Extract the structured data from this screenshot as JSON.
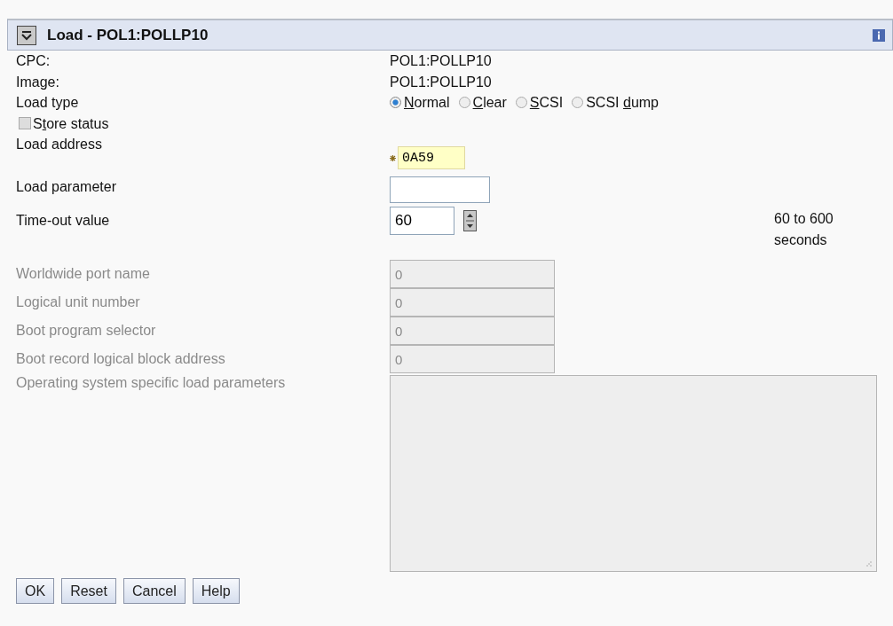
{
  "header": {
    "title": "Load - POL1:POLLP10",
    "expanded": true
  },
  "info_rows": [
    {
      "label": "CPC:",
      "value": "POL1:POLLP10"
    },
    {
      "label": "Image:",
      "value": "POL1:POLLP10"
    }
  ],
  "load_type": {
    "label": "Load type",
    "options": [
      {
        "key": "N",
        "post": "ormal",
        "selected": true
      },
      {
        "key": "C",
        "post": "lear",
        "selected": false
      },
      {
        "key": "S",
        "post": "CSI",
        "selected": false
      },
      {
        "pre": "SCSI ",
        "key": "d",
        "post": "ump",
        "selected": false
      }
    ]
  },
  "store_status": {
    "pre": "S",
    "key": "t",
    "post": "ore status",
    "checked": false
  },
  "load_address": {
    "label": "Load address",
    "value": "0A59",
    "required": true
  },
  "load_parameter": {
    "label": "Load parameter"
  },
  "timeout": {
    "label": "Time-out value",
    "value": "60",
    "range": "60 to 600 seconds"
  },
  "scsi_fields": [
    {
      "label": "Worldwide port name",
      "value": "0",
      "disabled": true
    },
    {
      "label": "Logical unit number",
      "value": "0",
      "disabled": true
    },
    {
      "label": "Boot program selector",
      "value": "0",
      "disabled": true
    },
    {
      "label": "Boot record logical block address",
      "value": "0",
      "disabled": true
    }
  ],
  "os_parameters": {
    "label": "Operating system specific load parameters",
    "disabled": true
  },
  "buttons": [
    "OK",
    "Reset",
    "Cancel",
    "Help"
  ]
}
